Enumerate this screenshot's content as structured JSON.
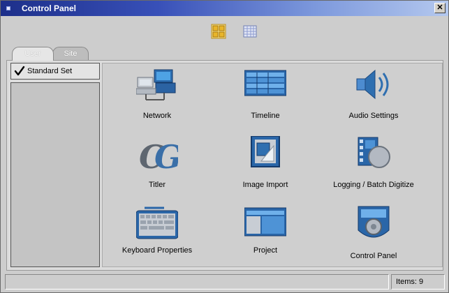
{
  "window": {
    "title": "Control Panel",
    "close_glyph": "✕"
  },
  "view_toggles": [
    {
      "icon": "large-icons-view-icon",
      "active": true
    },
    {
      "icon": "list-view-icon",
      "active": false
    }
  ],
  "tabs": [
    {
      "label": "User",
      "selected": true
    },
    {
      "label": "Site",
      "selected": false
    }
  ],
  "sets": [
    {
      "label": "Standard Set",
      "checked": true
    }
  ],
  "items": [
    {
      "label": "Network",
      "icon": "network-icon"
    },
    {
      "label": "Timeline",
      "icon": "timeline-icon"
    },
    {
      "label": "Audio Settings",
      "icon": "audio-settings-icon"
    },
    {
      "label": "Titler",
      "icon": "titler-icon"
    },
    {
      "label": "Image Import",
      "icon": "image-import-icon"
    },
    {
      "label": "Logging / Batch Digitize",
      "icon": "logging-batch-digitize-icon"
    },
    {
      "label": "Keyboard Properties",
      "icon": "keyboard-properties-icon"
    },
    {
      "label": "Project",
      "icon": "project-icon"
    },
    {
      "label": "Control Panel",
      "icon": "control-panel-icon"
    }
  ],
  "status": {
    "main": "",
    "items_count": "Items: 9"
  },
  "colors": {
    "accent_blue": "#2f6fb0",
    "title_gradient_start": "#1d2f8a",
    "title_gradient_end": "#b4c8ee"
  }
}
